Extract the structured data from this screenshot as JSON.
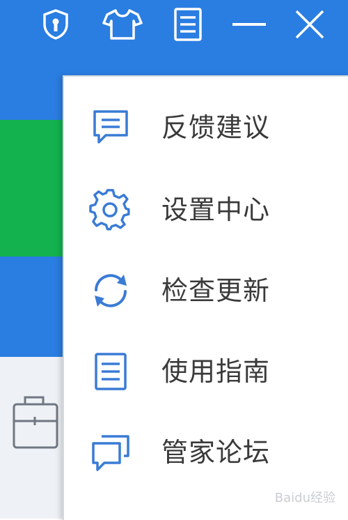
{
  "colors": {
    "titlebar_blue": "#2a7de1",
    "accent_green": "#13b24f",
    "icon_blue": "#3a7bd5",
    "menu_text": "#3a3a3a"
  },
  "titlebar": {
    "buttons": [
      {
        "icon": "shield-icon"
      },
      {
        "icon": "shirt-icon"
      },
      {
        "icon": "menu-icon"
      },
      {
        "icon": "minimize-icon"
      },
      {
        "icon": "close-icon"
      }
    ]
  },
  "menu": {
    "items": [
      {
        "label": "反馈建议",
        "icon": "feedback-icon"
      },
      {
        "label": "设置中心",
        "icon": "gear-icon"
      },
      {
        "label": "检查更新",
        "icon": "refresh-icon"
      },
      {
        "label": "使用指南",
        "icon": "guide-icon"
      },
      {
        "label": "管家论坛",
        "icon": "forum-icon"
      }
    ]
  },
  "watermark": "Baidu经验"
}
